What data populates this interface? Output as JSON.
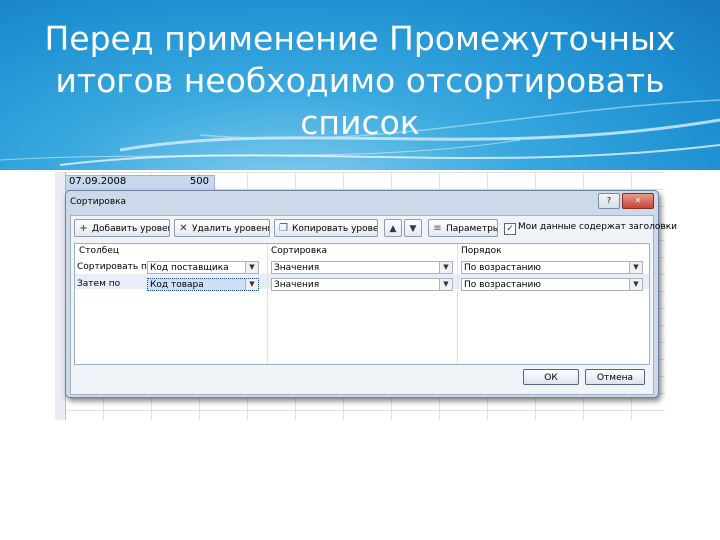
{
  "slide": {
    "title_lines": [
      "Перед применение Промежуточных",
      "итогов необходимо отсортировать",
      "список"
    ]
  },
  "sheet": {
    "cell_date": "07.09.2008",
    "cell_value": "500"
  },
  "dialog": {
    "title": "Сортировка",
    "help_label": "?",
    "close_label": "✕",
    "toolbar": {
      "add_level": "Добавить уровень",
      "delete_level": "Удалить уровень",
      "copy_level": "Копировать уровень",
      "move_up": "▲",
      "move_down": "▼",
      "options": "Параметры...",
      "headers_checkbox_label": "Мои данные содержат заголовки",
      "headers_checked": true
    },
    "columns": {
      "column": "Столбец",
      "sort_on": "Сортировка",
      "order": "Порядок"
    },
    "rows": [
      {
        "label": "Сортировать по",
        "column": "Код поставщика",
        "sort_on": "Значения",
        "order": "По возрастанию"
      },
      {
        "label": "Затем по",
        "column": "Код товара",
        "sort_on": "Значения",
        "order": "По возрастанию"
      }
    ],
    "ok_label": "ОК",
    "cancel_label": "Отмена"
  },
  "icons": {
    "add": "add-level-icon",
    "delete": "delete-level-icon",
    "copy": "copy-level-icon",
    "dropdown": "chevron-down-icon"
  }
}
